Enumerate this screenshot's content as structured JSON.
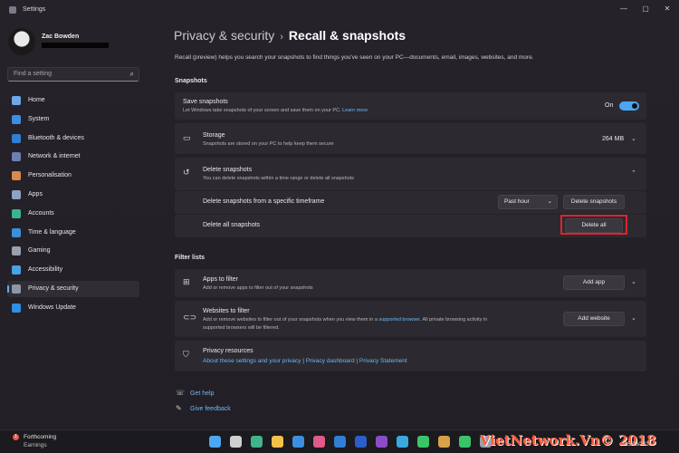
{
  "window": {
    "title": "Settings",
    "minimize": "—",
    "maximize": "▢",
    "close": "✕"
  },
  "user": {
    "name": "Zac Bowden"
  },
  "search": {
    "placeholder": "Find a setting"
  },
  "nav": [
    {
      "label": "Home",
      "icon": "home-icon",
      "color": "#6fa7e8"
    },
    {
      "label": "System",
      "icon": "system-icon",
      "color": "#3c8fe0"
    },
    {
      "label": "Bluetooth & devices",
      "icon": "bluetooth-icon",
      "color": "#2f7fd6"
    },
    {
      "label": "Network & internet",
      "icon": "network-icon",
      "color": "#6e7fb3"
    },
    {
      "label": "Personalisation",
      "icon": "personalisation-icon",
      "color": "#d98a4c"
    },
    {
      "label": "Apps",
      "icon": "apps-icon",
      "color": "#8ea1c7"
    },
    {
      "label": "Accounts",
      "icon": "accounts-icon",
      "color": "#39b58b"
    },
    {
      "label": "Time & language",
      "icon": "time-language-icon",
      "color": "#3b8fd9"
    },
    {
      "label": "Gaming",
      "icon": "gaming-icon",
      "color": "#9aa0ad"
    },
    {
      "label": "Accessibility",
      "icon": "accessibility-icon",
      "color": "#4aa2e6"
    },
    {
      "label": "Privacy & security",
      "icon": "shield-icon",
      "color": "#8f96a3"
    },
    {
      "label": "Windows Update",
      "icon": "windows-update-icon",
      "color": "#2f8fe2"
    }
  ],
  "breadcrumb": {
    "parent": "Privacy & security",
    "separator": "›",
    "current": "Recall & snapshots"
  },
  "intro": "Recall (preview) helps you search your snapshots to find things you've seen on your PC—documents, email, images, websites, and more.",
  "snapshots_section": "Snapshots",
  "save_snapshots": {
    "title": "Save snapshots",
    "desc": "Let Windows take snapshots of your screen and save them on your PC.",
    "link": "Learn more",
    "state": "On"
  },
  "storage": {
    "title": "Storage",
    "desc": "Snapshots are stored on your PC to help keep them secure",
    "value": "264 MB"
  },
  "delete_snapshots": {
    "title": "Delete snapshots",
    "desc": "You can delete snapshots within a time range or delete all snapshots",
    "timeframe_label": "Delete snapshots from a specific timeframe",
    "timeframe_value": "Past hour",
    "timeframe_button": "Delete snapshots",
    "all_label": "Delete all snapshots",
    "all_button": "Delete all"
  },
  "filter_section": "Filter lists",
  "apps_filter": {
    "title": "Apps to filter",
    "desc": "Add or remove apps to filter out of your snapshots",
    "button": "Add app"
  },
  "websites_filter": {
    "title": "Websites to filter",
    "desc1": "Add or remove websites to filter out of your snapshots when you view them in a",
    "link": "supported browser",
    "desc2": ". All private browsing activity in",
    "desc3": "supported browsers will be filtered.",
    "button": "Add website"
  },
  "privacy_resources": {
    "title": "Privacy resources",
    "link1": "About these settings and your privacy",
    "link2": "Privacy dashboard",
    "link3": "Privacy Statement",
    "sep": "|"
  },
  "footer": {
    "help": "Get help",
    "feedback": "Give feedback"
  },
  "taskbar": {
    "weather_title": "Forthcoming",
    "weather_sub": "Earnings",
    "badge": "1",
    "date": "05/06/2024",
    "icons": [
      {
        "name": "start-icon",
        "color": "#4aa8f0"
      },
      {
        "name": "search-taskbar-icon",
        "color": "#cfcfcf"
      },
      {
        "name": "edge-icon",
        "color": "#3fb58a"
      },
      {
        "name": "explorer-icon",
        "color": "#f2c14a"
      },
      {
        "name": "store-icon",
        "color": "#3c8fe0"
      },
      {
        "name": "photos-icon",
        "color": "#e05a8a"
      },
      {
        "name": "outlook-icon",
        "color": "#2f7fd6"
      },
      {
        "name": "word-icon",
        "color": "#2b5ec9"
      },
      {
        "name": "onenote-icon",
        "color": "#8a4cc9"
      },
      {
        "name": "telegram-icon",
        "color": "#3aa8e0"
      },
      {
        "name": "whatsapp-icon",
        "color": "#3ac46a"
      },
      {
        "name": "copilot-icon",
        "color": "#d9a04a"
      },
      {
        "name": "spotify-icon",
        "color": "#3ac46a"
      },
      {
        "name": "settings-taskbar-icon",
        "color": "#9aa0ad"
      }
    ]
  },
  "watermark": "VietNetwork.Vn© 2018"
}
